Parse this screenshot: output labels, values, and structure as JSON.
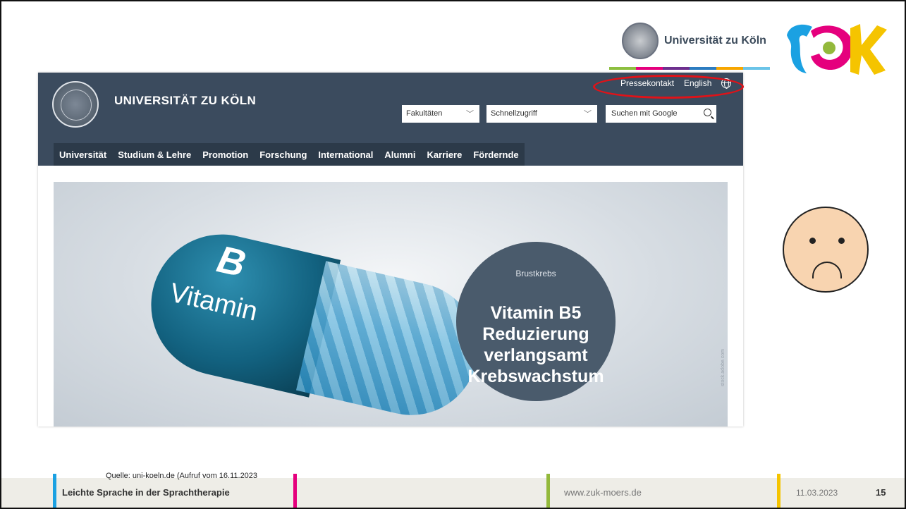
{
  "branding": {
    "university_name": "Universität zu Köln",
    "stripe_colors": [
      "#8dbf3f",
      "#e5007d",
      "#6d2f8e",
      "#2d7cc0",
      "#f7a600",
      "#6bc4e8"
    ]
  },
  "website": {
    "title": "UNIVERSITÄT ZU KÖLN",
    "top_links": {
      "press": "Pressekontakt",
      "language": "English",
      "language_icon": "globe-icon"
    },
    "selects": {
      "faculties": "Fakultäten",
      "quick_access": "Schnellzugriff"
    },
    "search": {
      "placeholder": "Suchen mit Google",
      "icon": "search-icon"
    },
    "nav": [
      "Universität",
      "Studium & Lehre",
      "Promotion",
      "Forschung",
      "International",
      "Alumni",
      "Karriere",
      "Fördernde"
    ],
    "hero": {
      "pill_letter": "B",
      "pill_text": "Vitamin",
      "badge_category": "Brustkrebs",
      "badge_title_lines": [
        "Vitamin B5",
        "Reduzierung",
        "verlangsamt",
        "Krebswachstum"
      ],
      "credit": "stock.adobe.com"
    },
    "highlight_color": "#e01218"
  },
  "face": {
    "icon": "sad-face-icon",
    "fill": "#f8d4b0"
  },
  "source_note": "Quelle: uni-koeln.de (Aufruf vom 16.11.2023",
  "footer": {
    "title": "Leichte Sprache in der Sprachtherapie",
    "url": "www.zuk-moers.de",
    "date": "11.03.2023",
    "page": "15",
    "bar_colors": [
      "#1ba1e2",
      "#e5007d",
      "#93b93b",
      "#f5c400"
    ]
  }
}
